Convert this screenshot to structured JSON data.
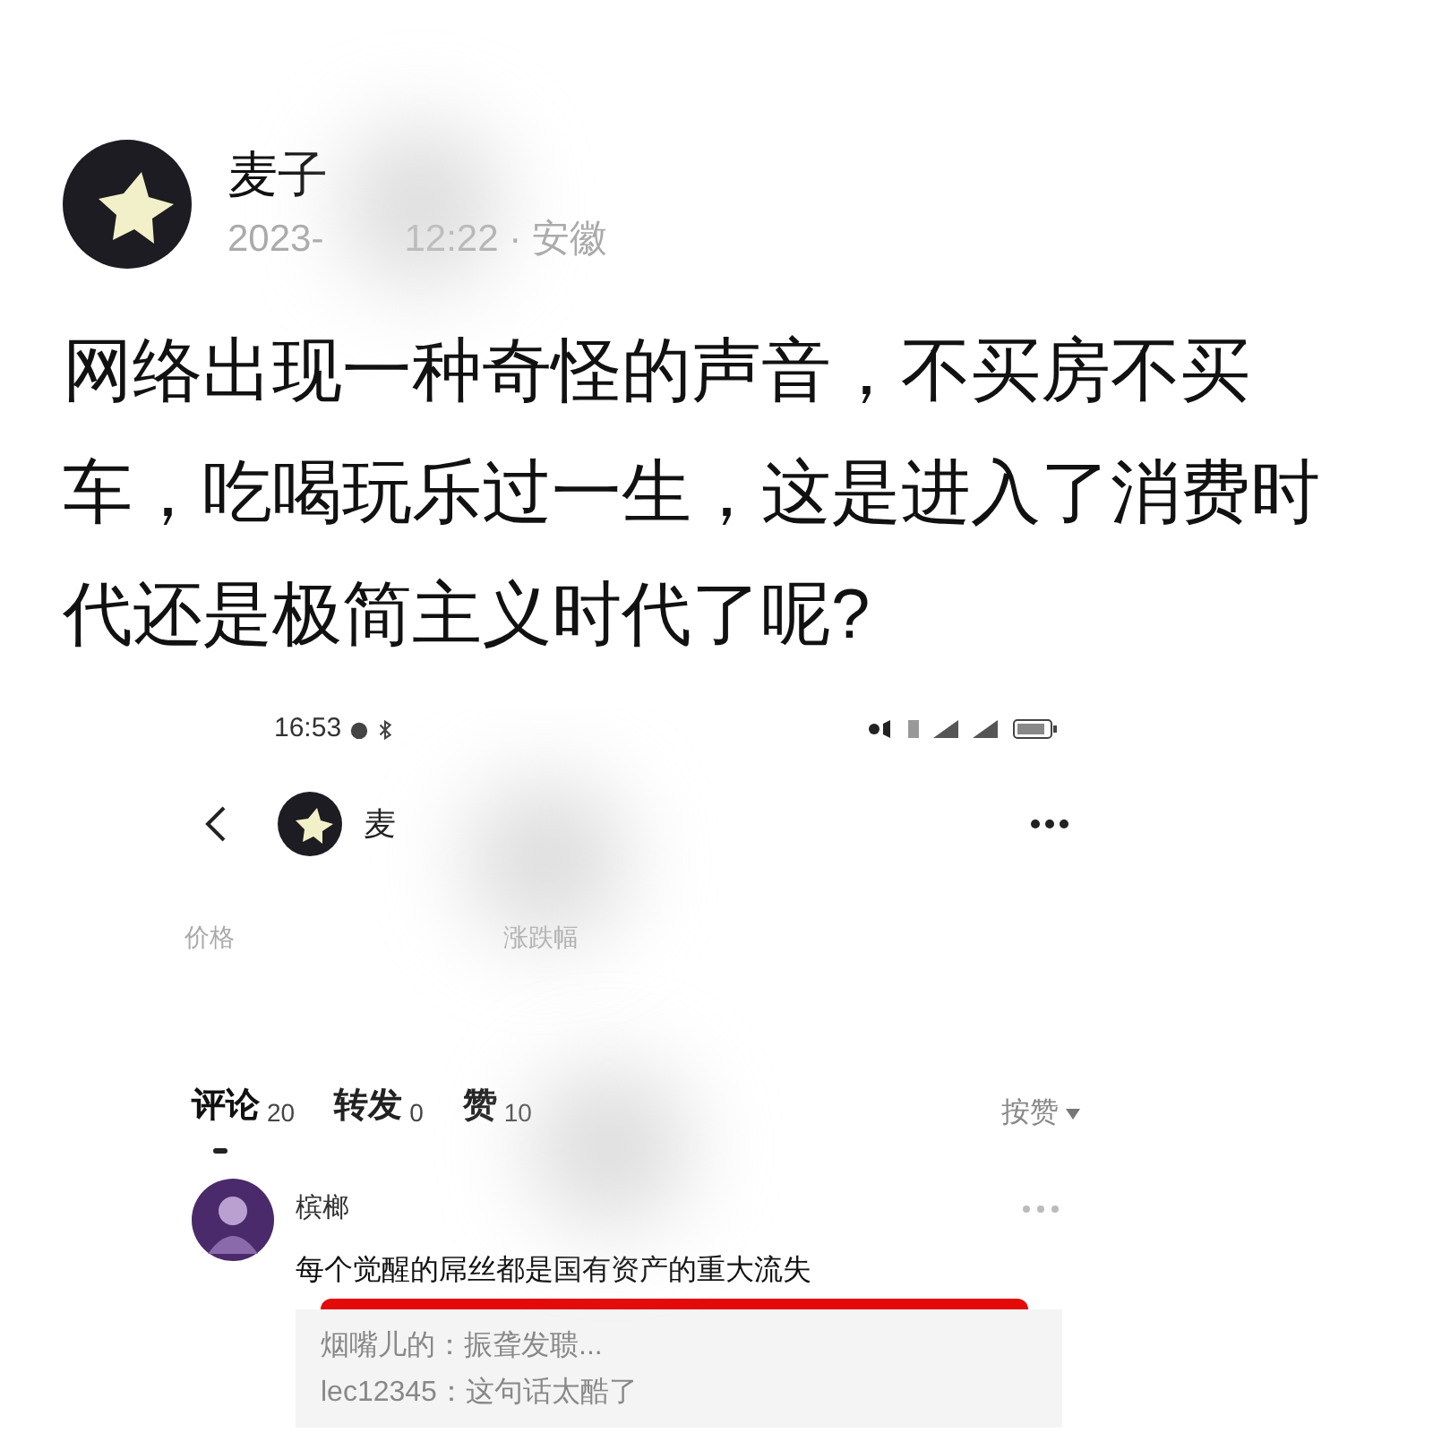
{
  "post": {
    "author": "麦子",
    "date": "2023-",
    "time_place": "12:22 · 安徽",
    "text": "网络出现一种奇怪的声音，不买房不买车，吃喝玩乐过一生，这是进入了消费时代还是极简主义时代了呢?"
  },
  "embedded": {
    "status_bar": {
      "time": "16:53"
    },
    "header": {
      "name": "麦"
    },
    "stats": [
      "价格",
      "涨跌幅"
    ],
    "tabs": [
      {
        "label": "评论",
        "count": "20",
        "selected": true
      },
      {
        "label": "转发",
        "count": "0",
        "selected": false
      },
      {
        "label": "赞",
        "count": "10",
        "selected": false
      }
    ],
    "sort": "按赞",
    "comments": [
      {
        "author": "槟榔",
        "text": "每个觉醒的屌丝都是国有资产的重大流失",
        "highlighted": true,
        "replies": [
          "烟嘴儿的：振聋发聩...",
          "lec12345：这句话太酷了"
        ]
      }
    ]
  }
}
